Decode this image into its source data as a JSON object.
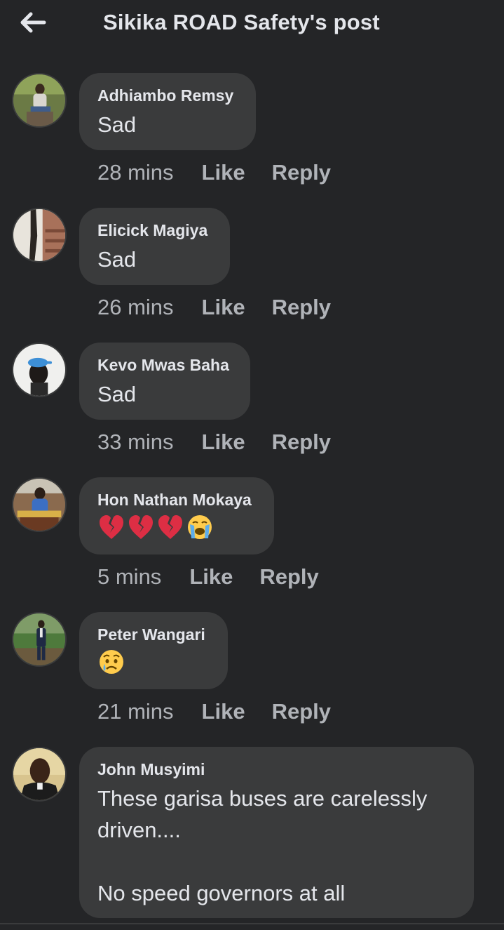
{
  "header": {
    "back_icon": "arrow-left-icon",
    "title": "Sikika ROAD Safety's post"
  },
  "comments": [
    {
      "author": "Adhiambo Remsy",
      "text": "Sad",
      "time": "28 mins",
      "like": "Like",
      "reply": "Reply"
    },
    {
      "author": "Elicick Magiya",
      "text": "Sad",
      "time": "26 mins",
      "like": "Like",
      "reply": "Reply"
    },
    {
      "author": "Kevo Mwas Baha",
      "text": "Sad",
      "time": "33 mins",
      "like": "Like",
      "reply": "Reply"
    },
    {
      "author": "Hon Nathan Mokaya",
      "emojis": [
        "broken-heart-icon",
        "broken-heart-icon",
        "broken-heart-icon",
        "loudly-crying-face-icon"
      ],
      "time": "5 mins",
      "like": "Like",
      "reply": "Reply"
    },
    {
      "author": "Peter Wangari",
      "emojis": [
        "crying-face-icon"
      ],
      "time": "21 mins",
      "like": "Like",
      "reply": "Reply"
    },
    {
      "author": "John Musyimi",
      "text": "These garisa buses are carelessly\ndriven....\n\nNo speed governors at all"
    }
  ],
  "colors": {
    "background": "#242527",
    "bubble": "#3a3b3c",
    "primary_text": "#e4e6eb",
    "secondary_text": "#b0b3b8"
  }
}
